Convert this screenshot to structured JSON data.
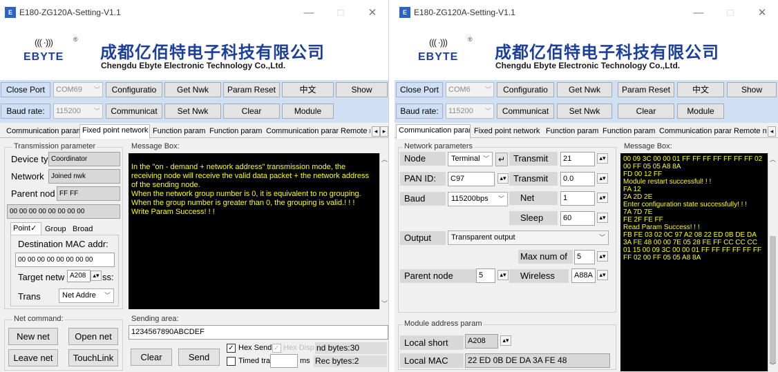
{
  "left": {
    "title": "E180-ZG120A-Setting-V1.1",
    "icon_text": "E",
    "window_controls": {
      "minimize": "—",
      "maximize": "□",
      "close": "✕"
    },
    "banner": {
      "wave": "((( ·)))",
      "reg": "®",
      "brand": "EBYTE",
      "cn_title": "成都亿佰特电子科技有限公司",
      "en_title": "Chengdu Ebyte Electronic Technology Co.,Ltd."
    },
    "buttons": {
      "close_port": "Close Port",
      "port": "COM69",
      "configuration": "Configuratio",
      "get_nwk": "Get Nwk",
      "param_reset": "Param Reset",
      "lang": "中文",
      "show": "Show",
      "baud_label": "Baud rate:",
      "baud_value": "115200",
      "communication": "Communicat",
      "set_nwk": "Set Nwk",
      "clear": "Clear",
      "module": "Module"
    },
    "tabs": [
      "Communication param",
      "Fixed point network",
      "Function param",
      "Function param",
      "Communication param",
      "Remote n"
    ],
    "tab_scroll": {
      "left": "◂",
      "right": "▸"
    },
    "transmission": {
      "group_label": "Transmission parameter",
      "device_type_label": "Device typ",
      "device_type_value": "Coordinator",
      "network_label": "Network",
      "network_value": "Joined nwk",
      "parent_label": "Parent nod",
      "parent_value": "FF FF",
      "mac_value": "00 00 00 00 00 00 00 00",
      "subtabs": [
        "Point✓",
        "Group",
        "Broad"
      ],
      "dest_mac_label": "Destination MAC addr:",
      "dest_mac_value": "00 00 00 00 00 00 00 00",
      "target_label": "Target netw",
      "target_value": "A208",
      "target_suffix": "ss:",
      "trans_label": "Trans",
      "trans_value": "Net Addre"
    },
    "message": {
      "label": "Message Box:",
      "lines": [
        "In the \"on - demand + network address\" transmission mode, the receiving node will receive the valid data packet + the network address of the sending node.",
        "",
        "When the network group number is 0, it is equivalent to no grouping.\nWhen the group number is greater than 0, the grouping is valid.! ! !",
        "",
        "Write Param Success! ! !"
      ]
    },
    "net_command": {
      "label": "Net command:",
      "new_net": "New net",
      "open_net": "Open net",
      "leave_net": "Leave net",
      "touchlink": "TouchLink"
    },
    "sending": {
      "label": "Sending area:",
      "value": "1234567890ABCDEF",
      "clear": "Clear",
      "send": "Send",
      "hex_send": "Hex Send",
      "hex_display": "Hex Display",
      "send_bytes": "nd bytes:30",
      "timed": "Timed tran",
      "ms": "ms",
      "rec_bytes": "Rec bytes:2"
    }
  },
  "right": {
    "title": "E180-ZG120A-Setting-V1.1",
    "icon_text": "E",
    "window_controls": {
      "minimize": "—",
      "maximize": "□",
      "close": "✕"
    },
    "banner": {
      "wave": "((( ·)))",
      "reg": "®",
      "brand": "EBYTE",
      "cn_title": "成都亿佰特电子科技有限公司",
      "en_title": "Chengdu Ebyte Electronic Technology Co.,Ltd."
    },
    "buttons": {
      "close_port": "Close Port",
      "port": "COM6",
      "configuration": "Configuratio",
      "get_nwk": "Get Nwk",
      "param_reset": "Param Reset",
      "lang": "中文",
      "show": "Show",
      "baud_label": "Baud rate:",
      "baud_value": "115200",
      "communication": "Communicat",
      "set_nwk": "Set Nwk",
      "clear": "Clear",
      "module": "Module"
    },
    "tabs": [
      "Communication param",
      "Fixed point network",
      "Function param",
      "Function param",
      "Communication param",
      "Remote n"
    ],
    "tab_scroll": {
      "right": "◂"
    },
    "network": {
      "group_label": "Network parameters",
      "node_label": "Node",
      "node_value": "Terminal",
      "enter_glyph": "↵",
      "transmit1_label": "Transmit",
      "transmit1_value": "21",
      "pan_label": "PAN  ID:",
      "pan_value": "C97",
      "transmit2_label": "Transmit",
      "transmit2_value": "0.0",
      "baud_label": "Baud",
      "baud_value": "115200bps",
      "net_label": "Net",
      "net_value": "1",
      "sleep_label": "Sleep",
      "sleep_value": "60",
      "output_label": "Output",
      "output_value": "Transparent output",
      "maxnum_label": "Max num of",
      "maxnum_value": "5",
      "parent_label": "Parent node",
      "parent_value": "5",
      "wireless_label": "Wireless",
      "wireless_value": "A88A"
    },
    "module_addr": {
      "group_label": "Module address param",
      "local_short_label": "Local short",
      "local_short_value": "A208",
      "local_mac_label": "Local MAC",
      "local_mac_value": "22 ED 0B DE DA 3A FE 48"
    },
    "message": {
      "label": "Message Box:",
      "lines": [
        "00 09 3C 00 00 01 FF FF FF FF FF FF FF 02 00 FF 05 05 A8 8A",
        "",
        "FD 00 12 FF",
        "",
        "Module restart successful! ! !",
        "",
        "FA 12",
        "",
        "2A 2D 2E",
        "",
        "Enter configuration state successfully! ! !",
        "",
        "7A 7D 7E",
        "",
        "FE 2F FE FF",
        "",
        "Read Param Success! ! !",
        "",
        "FB FE 03 02 0C 97 A2 08 22 ED 0B DE DA 3A FE 48 00 00 7E 05 28 FE FF CC CC CC 01 15 00 09 3C 00 00 01 FF FF FF FF FF FF FF 02 00 FF 05 05 A8 8A"
      ]
    }
  }
}
